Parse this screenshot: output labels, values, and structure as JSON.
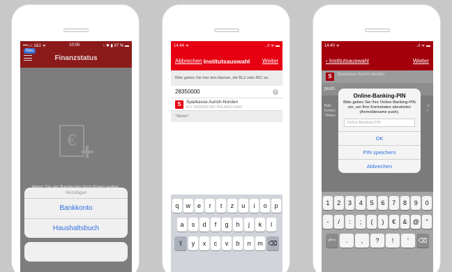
{
  "screen1": {
    "status": {
      "left": "•••○○ 1&1 ᯤ",
      "time": "10:05",
      "right": "↑ ✱ ▮ 87 % ▬"
    },
    "new_badge": "Neu",
    "title": "Finanzstatus",
    "hint": "Wenn Sie ein Bankkonto hinzufügen wollen,",
    "sheet_title": "Hinzufügen",
    "options": [
      "Bankkonto",
      "Haushaltsbuch"
    ]
  },
  "screen2": {
    "status": {
      "time": "14:44 ᯤ",
      "right": "..ıl ᯤ ▬"
    },
    "nav": {
      "left": "Abbrechen",
      "title": "Institutsauswahl",
      "right": "Weiter"
    },
    "instruction": "Bitte geben Sie hier den Namen, die BLZ oder BIC an.",
    "search_value": "28350000",
    "result": {
      "name": "Sparkasse Aurich-Norden",
      "meta": "BLZ 28350000  BIC BRLADE21ANO"
    },
    "weiter_note": "\"Weiter\".",
    "keyboard": {
      "row1": [
        "q",
        "w",
        "e",
        "r",
        "t",
        "z",
        "u",
        "i",
        "o",
        "p"
      ],
      "row2": [
        "a",
        "s",
        "d",
        "f",
        "g",
        "h",
        "j",
        "k",
        "l"
      ],
      "row3": [
        "y",
        "x",
        "c",
        "v",
        "b",
        "n",
        "m"
      ],
      "shift": "⇧",
      "backspace": "⌫"
    }
  },
  "screen3": {
    "status": {
      "time": "14:40 ᯤ",
      "right": "..ıl ᯤ ▬"
    },
    "nav": {
      "back": "‹ Institutsauswahl",
      "right": "Weiter"
    },
    "bank_name": "Sparkasse Aurich-Norden",
    "push_label": "push",
    "left_fragment": "Bitte\nKonten\n\"Weiter",
    "right_fragment": "n-\nr\n",
    "alert": {
      "title": "Online-Banking-PIN",
      "message": "Bitte geben Sie Ihre Online-Banking-PIN ein, um Ihre Kontodaten abzuholen (Anmeldename push).",
      "placeholder": "Online-Banking-PIN",
      "buttons": [
        "OK",
        "PIN speichern",
        "Abbrechen"
      ]
    },
    "numpad": {
      "row1": [
        "1",
        "2",
        "3",
        "4",
        "5",
        "6",
        "7",
        "8",
        "9",
        "0"
      ],
      "row2": [
        "-",
        "/",
        ":",
        ";",
        "(",
        ")",
        "€",
        "&",
        "@",
        "\""
      ],
      "row3": [
        "#+=",
        ".",
        ",",
        "?",
        "!",
        "'",
        "⌫"
      ]
    }
  }
}
